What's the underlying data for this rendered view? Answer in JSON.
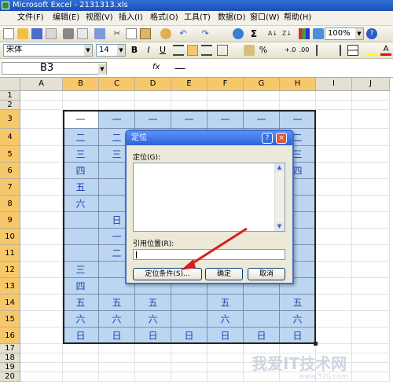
{
  "window": {
    "title": "Microsoft Excel - 2131313.xls"
  },
  "menu": [
    "文件(F)",
    "编辑(E)",
    "视图(V)",
    "插入(I)",
    "格式(O)",
    "工具(T)",
    "数据(D)",
    "窗口(W)",
    "帮助(H)"
  ],
  "toolbar": {
    "zoom": "100%",
    "font": "宋体",
    "font_size": "14",
    "bold": "B",
    "italic": "I",
    "underline": "U",
    "percent": "%",
    "sigma": "Σ"
  },
  "formula_bar": {
    "cell_ref": "B3",
    "fx": "fx",
    "value": "一"
  },
  "sheet": {
    "columns": [
      "A",
      "B",
      "C",
      "D",
      "E",
      "F",
      "G",
      "H",
      "I",
      "J"
    ],
    "rows": [
      "1",
      "2",
      "3",
      "4",
      "5",
      "6",
      "7",
      "8",
      "9",
      "10",
      "11",
      "12",
      "13",
      "14",
      "15",
      "16",
      "17",
      "18",
      "19",
      "20"
    ],
    "cells": {
      "B3": "一",
      "C3": "一",
      "D3": "一",
      "E3": "一",
      "F3": "一",
      "G3": "一",
      "H3": "一",
      "B4": "二",
      "C4": "二",
      "H4": "二",
      "B5": "三",
      "C5": "三",
      "H5": "三",
      "B6": "四",
      "H6": "四",
      "B7": "五",
      "B8": "六",
      "C9": "日",
      "C10": "一",
      "C11": "二",
      "B12": "三",
      "B13": "四",
      "B14": "五",
      "C14": "五",
      "D14": "五",
      "F14": "五",
      "H14": "五",
      "B15": "六",
      "C15": "六",
      "D15": "六",
      "F15": "六",
      "H15": "六",
      "B16": "日",
      "C16": "日",
      "D16": "日",
      "E16": "日",
      "F16": "日",
      "G16": "日",
      "H16": "日"
    }
  },
  "dialog": {
    "title": "定位",
    "help": "?",
    "close": "×",
    "goto_label": "定位(G):",
    "ref_label": "引用位置(R):",
    "ref_value": "",
    "special_button": "定位条件(S)...",
    "ok_button": "确定",
    "cancel_button": "取消"
  },
  "watermark": {
    "text": "我爱IT技术网",
    "url": "www.52ij.com"
  },
  "colors": {
    "selection": "#bcd6f2",
    "header_selected": "#f7c86a",
    "title_bar": "#2b63d9",
    "arrow": "#d42020",
    "cell_text": "#1e3fb0"
  }
}
